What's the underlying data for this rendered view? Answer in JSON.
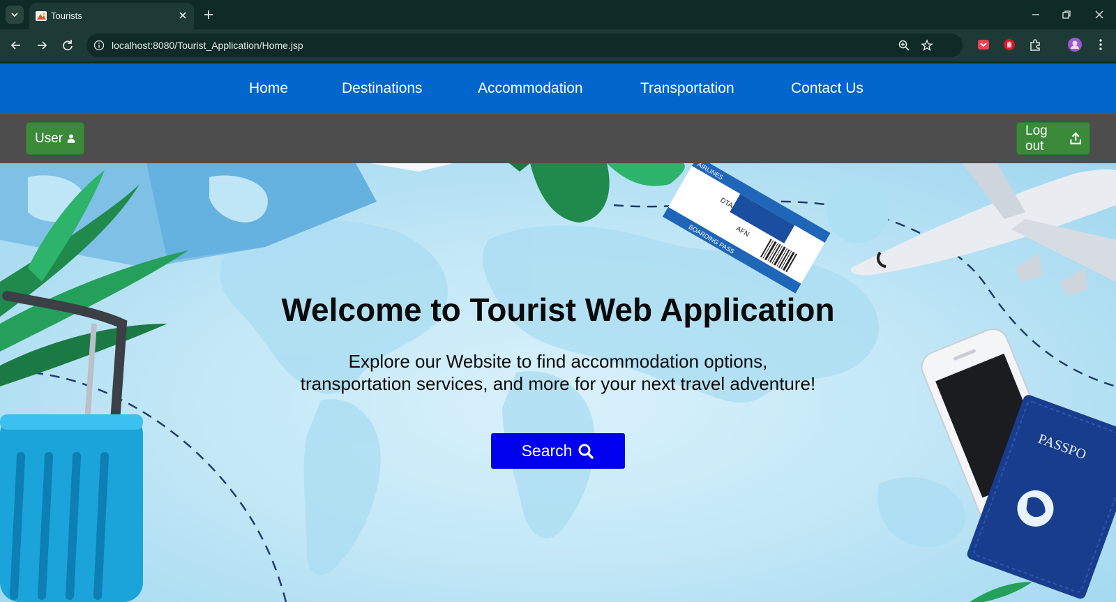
{
  "browser": {
    "tab_title": "Tourists",
    "url": "localhost:8080/Tourist_Application/Home.jsp"
  },
  "nav": {
    "items": [
      "Home",
      "Destinations",
      "Accommodation",
      "Transportation",
      "Contact Us"
    ]
  },
  "userbar": {
    "user_label": "User",
    "logout_label": "Log out"
  },
  "hero": {
    "title": "Welcome to Tourist Web Application",
    "subtitle_line1": "Explore our Website to find accommodation options,",
    "subtitle_line2": "transportation services, and more for your next travel adventure!",
    "search_label": "Search"
  },
  "illustration": {
    "boarding_pass": [
      "AIRLINES",
      "BOARDING PASS",
      "AFN",
      "DTA"
    ],
    "passport": "PASSPO"
  },
  "colors": {
    "navbar": "#0066cc",
    "userbar": "#4d4d4d",
    "button_green": "#3a8a3a",
    "search_blue": "#0000ee"
  },
  "icons": [
    "tab-search-icon",
    "tourist-favicon-icon",
    "close-icon",
    "plus-icon",
    "minimize-icon",
    "restore-icon",
    "window-close-icon",
    "back-icon",
    "forward-icon",
    "reload-icon",
    "site-info-icon",
    "zoom-icon",
    "star-icon",
    "pocket-icon",
    "adblock-icon",
    "extensions-icon",
    "profile-avatar-icon",
    "menu-icon",
    "user-icon",
    "logout-icon",
    "search-icon"
  ]
}
